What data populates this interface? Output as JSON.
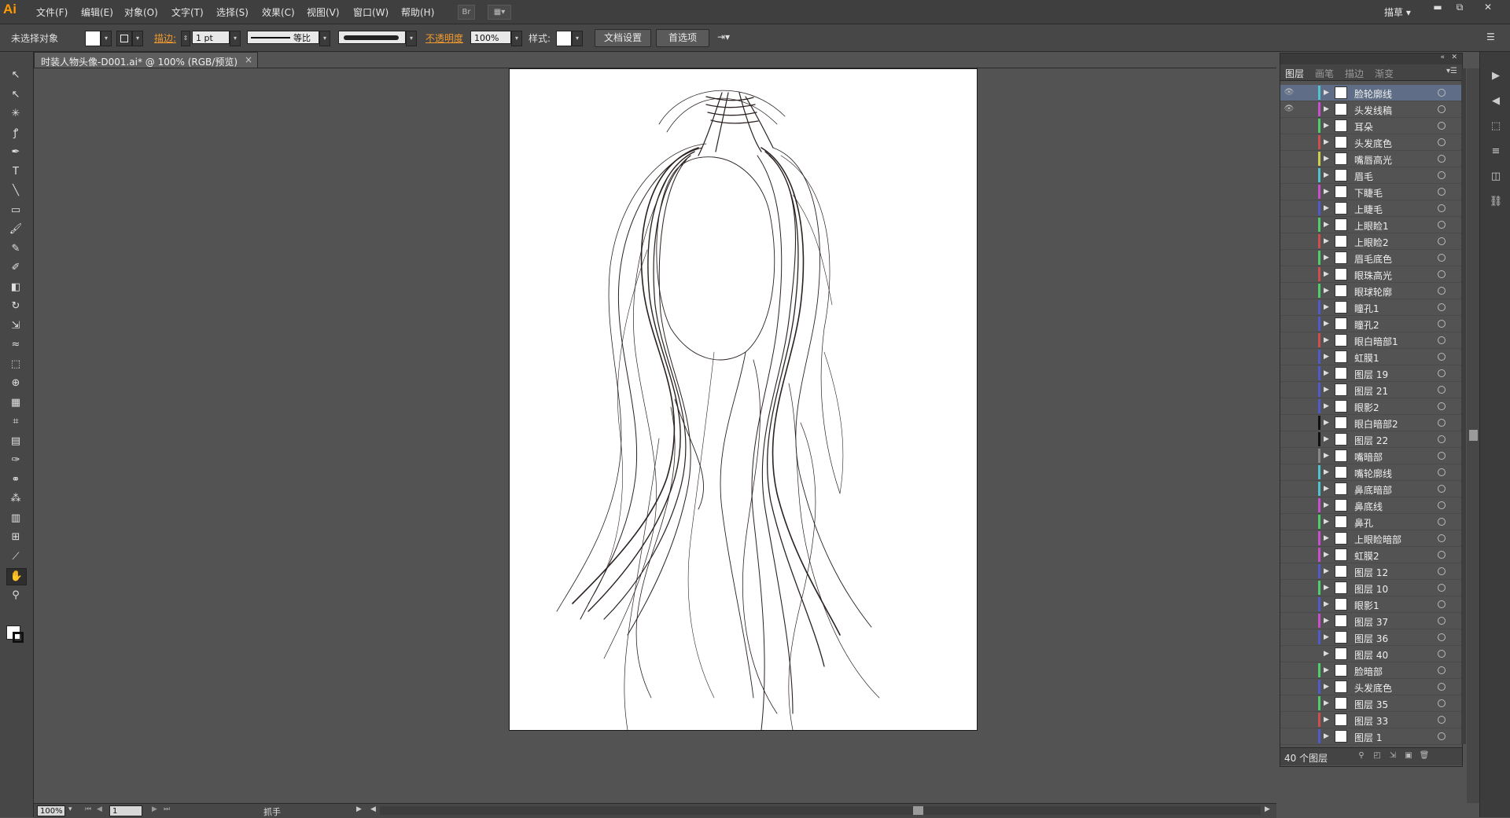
{
  "app": {
    "logo": "Ai"
  },
  "menus": [
    "文件(F)",
    "编辑(E)",
    "对象(O)",
    "文字(T)",
    "选择(S)",
    "效果(C)",
    "视图(V)",
    "窗口(W)",
    "帮助(H)"
  ],
  "menubar_right": {
    "workspace": "描草 ▾",
    "minimize": "▬",
    "restore": "⧉",
    "close": "✕"
  },
  "control_bar": {
    "selection_label": "未选择对象",
    "stroke_label": "描边:",
    "stroke_weight": "1 pt",
    "stroke_profile": "等比",
    "opacity_label": "不透明度",
    "opacity_value": "100%",
    "style_label": "样式:",
    "doc_setup_button": "文档设置",
    "preferences_button": "首选项"
  },
  "document": {
    "tab_title": "时装人物头像-D001.ai* @ 100% (RGB/预览)",
    "tab_close": "×"
  },
  "status_bar": {
    "zoom": "100%",
    "artboard_number": "1",
    "tool_name": "抓手"
  },
  "layers_panel": {
    "tabs": [
      "图层",
      "画笔",
      "描边",
      "渐变"
    ],
    "active_tab": "图层",
    "count_text": "40 个图层",
    "layers": [
      {
        "name": "脸轮廓线",
        "color": "#4fc4cf",
        "visible": true,
        "selected": true
      },
      {
        "name": "头发线稿",
        "color": "#c94fcf",
        "visible": true,
        "selected": false
      },
      {
        "name": "耳朵",
        "color": "#4fcf6a",
        "visible": false,
        "selected": false
      },
      {
        "name": "头发底色",
        "color": "#cf4f4f",
        "visible": false,
        "selected": false
      },
      {
        "name": "嘴唇高光",
        "color": "#cfcf4f",
        "visible": false,
        "selected": false
      },
      {
        "name": "眉毛",
        "color": "#4fc4cf",
        "visible": false,
        "selected": false
      },
      {
        "name": "下睫毛",
        "color": "#c94fcf",
        "visible": false,
        "selected": false
      },
      {
        "name": "上睫毛",
        "color": "#4f5acf",
        "visible": false,
        "selected": false
      },
      {
        "name": "上眼睑1",
        "color": "#4fcf6a",
        "visible": false,
        "selected": false
      },
      {
        "name": "上眼睑2",
        "color": "#cf4f4f",
        "visible": false,
        "selected": false
      },
      {
        "name": "眉毛底色",
        "color": "#4fcf6a",
        "visible": false,
        "selected": false
      },
      {
        "name": "眼珠高光",
        "color": "#cf4f4f",
        "visible": false,
        "selected": false
      },
      {
        "name": "眼球轮廓",
        "color": "#4fcf6a",
        "visible": false,
        "selected": false
      },
      {
        "name": "瞳孔1",
        "color": "#4f5acf",
        "visible": false,
        "selected": false
      },
      {
        "name": "瞳孔2",
        "color": "#4f5acf",
        "visible": false,
        "selected": false
      },
      {
        "name": "眼白暗部1",
        "color": "#cf4f4f",
        "visible": false,
        "selected": false
      },
      {
        "name": "虹膜1",
        "color": "#4f5acf",
        "visible": false,
        "selected": false
      },
      {
        "name": "图层 19",
        "color": "#4f5acf",
        "visible": false,
        "selected": false
      },
      {
        "name": "图层 21",
        "color": "#4f5acf",
        "visible": false,
        "selected": false
      },
      {
        "name": "眼影2",
        "color": "#4f5acf",
        "visible": false,
        "selected": false
      },
      {
        "name": "眼白暗部2",
        "color": "#111111",
        "visible": false,
        "selected": false
      },
      {
        "name": "图层 22",
        "color": "#111111",
        "visible": false,
        "selected": false
      },
      {
        "name": "嘴暗部",
        "color": "#888888",
        "visible": false,
        "selected": false
      },
      {
        "name": "嘴轮廓线",
        "color": "#4fc4cf",
        "visible": false,
        "selected": false
      },
      {
        "name": "鼻底暗部",
        "color": "#4fc4cf",
        "visible": false,
        "selected": false
      },
      {
        "name": "鼻底线",
        "color": "#c94fcf",
        "visible": false,
        "selected": false
      },
      {
        "name": "鼻孔",
        "color": "#4fcf6a",
        "visible": false,
        "selected": false
      },
      {
        "name": "上眼睑暗部",
        "color": "#c94fcf",
        "visible": false,
        "selected": false
      },
      {
        "name": "虹膜2",
        "color": "#c94fcf",
        "visible": false,
        "selected": false
      },
      {
        "name": "图层 12",
        "color": "#4f5acf",
        "visible": false,
        "selected": false
      },
      {
        "name": "图层 10",
        "color": "#4fcf6a",
        "visible": false,
        "selected": false
      },
      {
        "name": "眼影1",
        "color": "#4f5acf",
        "visible": false,
        "selected": false
      },
      {
        "name": "图层 37",
        "color": "#c94fcf",
        "visible": false,
        "selected": false
      },
      {
        "name": "图层 36",
        "color": "#4f5acf",
        "visible": false,
        "selected": false
      },
      {
        "name": "图层 40",
        "color": "#535353",
        "visible": false,
        "selected": false
      },
      {
        "name": "脸暗部",
        "color": "#4fcf6a",
        "visible": false,
        "selected": false
      },
      {
        "name": "头发底色",
        "color": "#4f5acf",
        "visible": false,
        "selected": false
      },
      {
        "name": "图层 35",
        "color": "#4fcf6a",
        "visible": false,
        "selected": false
      },
      {
        "name": "图层 33",
        "color": "#cf4f4f",
        "visible": false,
        "selected": false
      },
      {
        "name": "图层 1",
        "color": "#4f5acf",
        "visible": false,
        "selected": false
      }
    ]
  },
  "tools": [
    {
      "name": "selection-tool",
      "glyph": "↖"
    },
    {
      "name": "direct-selection-tool",
      "glyph": "↖"
    },
    {
      "name": "magic-wand-tool",
      "glyph": "✳"
    },
    {
      "name": "lasso-tool",
      "glyph": "ꝭ"
    },
    {
      "name": "pen-tool",
      "glyph": "✒"
    },
    {
      "name": "type-tool",
      "glyph": "T"
    },
    {
      "name": "line-tool",
      "glyph": "╲"
    },
    {
      "name": "rectangle-tool",
      "glyph": "▭"
    },
    {
      "name": "paintbrush-tool",
      "glyph": "🖌"
    },
    {
      "name": "pencil-tool",
      "glyph": "✎"
    },
    {
      "name": "blob-brush-tool",
      "glyph": "✐"
    },
    {
      "name": "eraser-tool",
      "glyph": "◧"
    },
    {
      "name": "rotate-tool",
      "glyph": "↻"
    },
    {
      "name": "scale-tool",
      "glyph": "⇲"
    },
    {
      "name": "warp-tool",
      "glyph": "≈"
    },
    {
      "name": "free-transform-tool",
      "glyph": "⬚"
    },
    {
      "name": "shape-builder-tool",
      "glyph": "⊕"
    },
    {
      "name": "perspective-grid-tool",
      "glyph": "▦"
    },
    {
      "name": "mesh-tool",
      "glyph": "⌗"
    },
    {
      "name": "gradient-tool",
      "glyph": "▤"
    },
    {
      "name": "eyedropper-tool",
      "glyph": "✑"
    },
    {
      "name": "blend-tool",
      "glyph": "⚭"
    },
    {
      "name": "symbol-sprayer-tool",
      "glyph": "⁂"
    },
    {
      "name": "column-graph-tool",
      "glyph": "▥"
    },
    {
      "name": "artboard-tool",
      "glyph": "⊞"
    },
    {
      "name": "slice-tool",
      "glyph": "⟋"
    },
    {
      "name": "hand-tool",
      "glyph": "✋"
    },
    {
      "name": "zoom-tool",
      "glyph": "⚲"
    }
  ],
  "dock_icons": [
    {
      "name": "play-icon",
      "glyph": "▶"
    },
    {
      "name": "expand-icon",
      "glyph": "◀"
    },
    {
      "name": "transform-icon",
      "glyph": "⬚"
    },
    {
      "name": "align-icon",
      "glyph": "≡"
    },
    {
      "name": "pathfinder-icon",
      "glyph": "◫"
    },
    {
      "name": "links-icon",
      "glyph": "⛓"
    }
  ]
}
